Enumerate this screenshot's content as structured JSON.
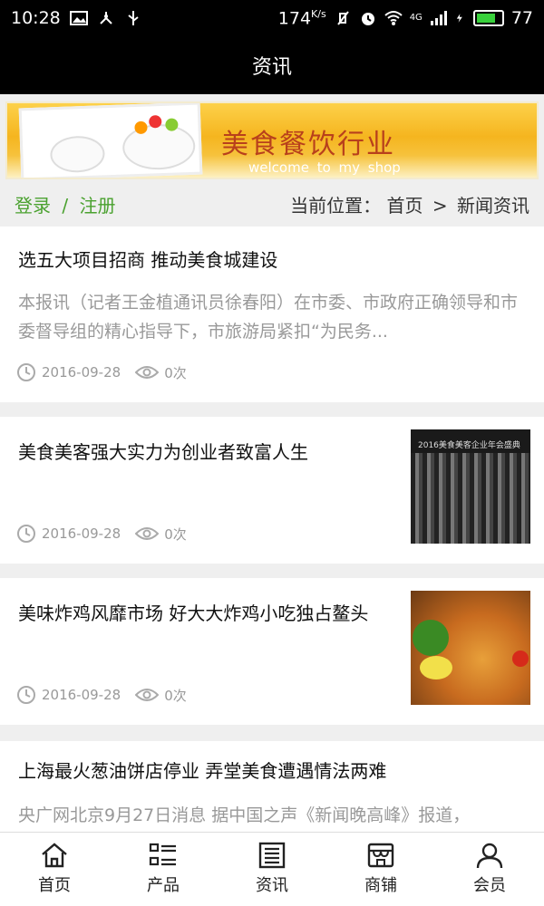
{
  "statusbar": {
    "time": "10:28",
    "speed": "174",
    "speed_unit": "K/s",
    "network": "4G",
    "battery": "77",
    "battery_level": 0.77
  },
  "titlebar": {
    "title": "资讯"
  },
  "banner": {
    "headline": "美食餐饮行业",
    "welcome": "welcome to my shop"
  },
  "locbar": {
    "login": "登录",
    "separator": "/",
    "register": "注册",
    "location_label": "当前位置：",
    "home": "首页",
    "arrow": ">",
    "current": "新闻资讯"
  },
  "news": [
    {
      "title": "选五大项目招商 推动美食城建设",
      "summary": "本报讯（记者王金植通讯员徐春阳）在市委、市政府正确领导和市委督导组的精心指导下，市旅游局紧扣“为民务...",
      "date": "2016-09-28",
      "views": "0次"
    },
    {
      "title": "美食美客强大实力为创业者致富人生",
      "date": "2016-09-28",
      "views": "0次",
      "image_caption": "2016美食美客企业年会盛典"
    },
    {
      "title": "美味炸鸡风靡市场 好大大炸鸡小吃独占鳌头",
      "date": "2016-09-28",
      "views": "0次"
    },
    {
      "title": "上海最火葱油饼店停业 弄堂美食遭遇情法两难",
      "summary": "央广网北京9月27日消息 据中国之声《新闻晚高峰》报道，"
    }
  ],
  "tabbar": {
    "items": [
      {
        "label": "首页",
        "icon": "home-icon"
      },
      {
        "label": "产品",
        "icon": "grid-list-icon"
      },
      {
        "label": "资讯",
        "icon": "news-icon"
      },
      {
        "label": "商铺",
        "icon": "store-icon"
      },
      {
        "label": "会员",
        "icon": "user-icon"
      }
    ]
  }
}
